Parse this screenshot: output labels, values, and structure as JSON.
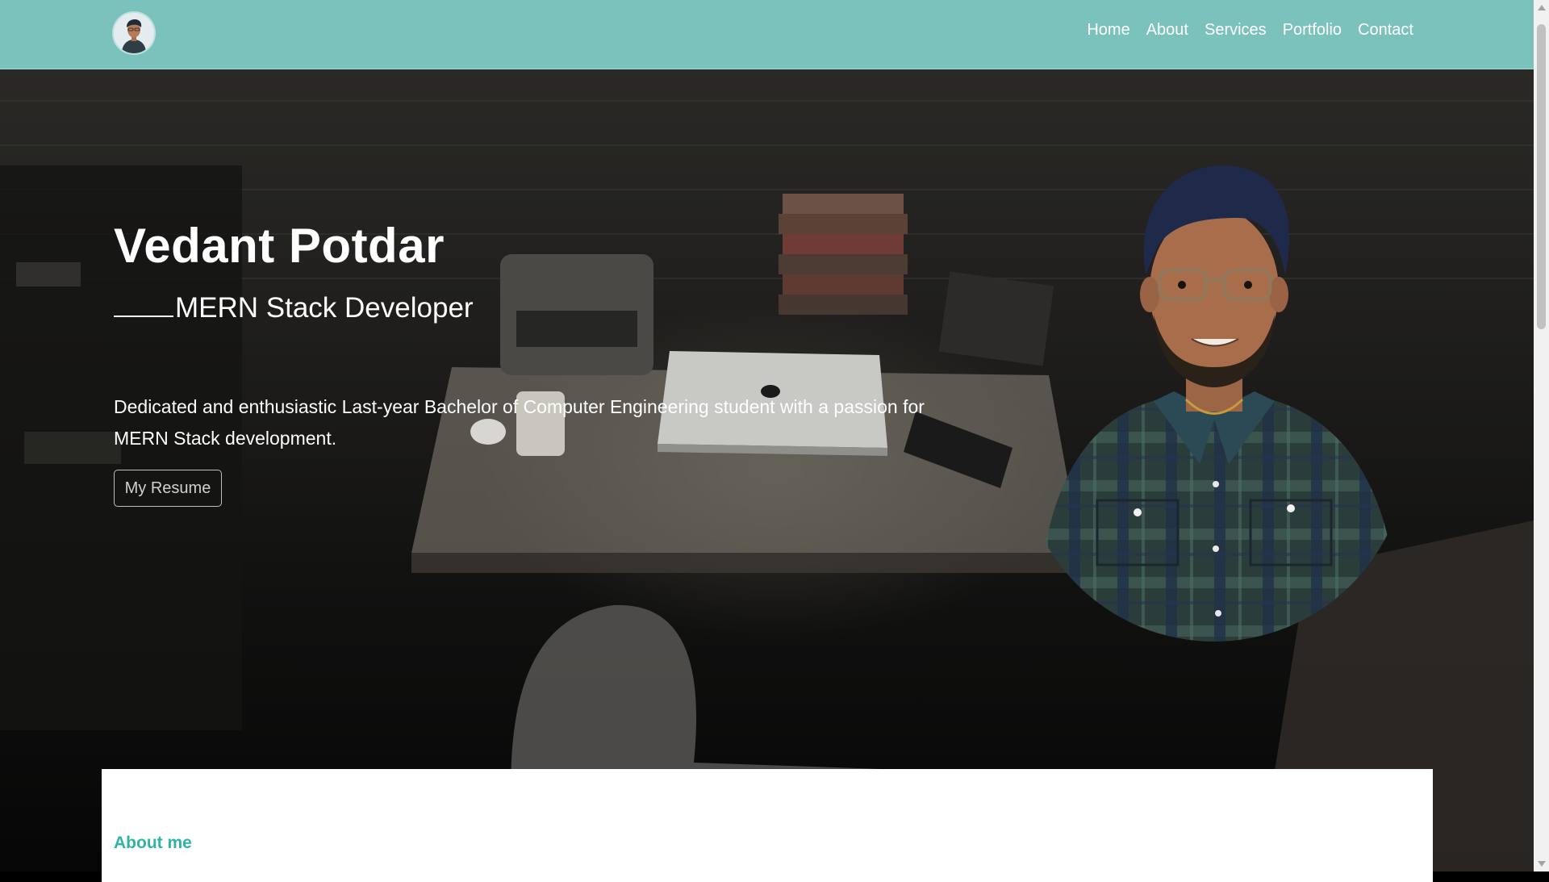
{
  "nav": {
    "links": [
      "Home",
      "About",
      "Services",
      "Portfolio",
      "Contact"
    ]
  },
  "hero": {
    "name": "Vedant Potdar",
    "role": "MERN Stack Developer",
    "description": "Dedicated and enthusiastic Last-year Bachelor of Computer Engineering student with a passion for MERN Stack development.",
    "resume_button": "My Resume"
  },
  "about": {
    "title": "About me"
  },
  "colors": {
    "navbar": "#7cc2bc",
    "accent": "#2fb3a5",
    "text": "#ffffff"
  },
  "icons": {
    "nav_avatar": "profile-photo",
    "hero_portrait": "portrait-photo"
  }
}
